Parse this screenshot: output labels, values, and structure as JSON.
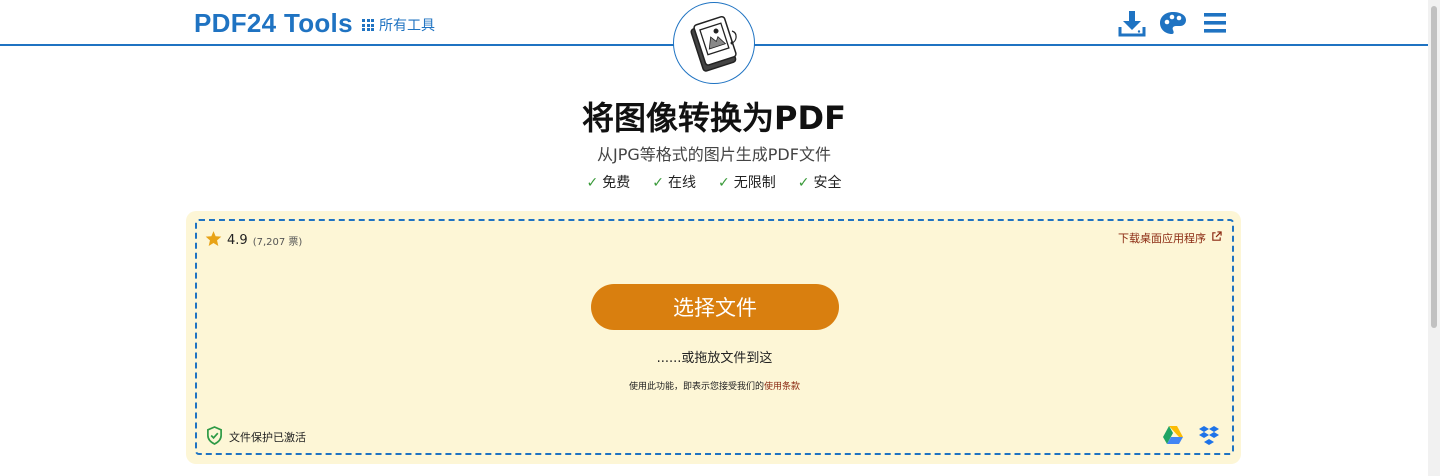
{
  "header": {
    "brand": "PDF24 Tools",
    "all_tools_label": "所有工具",
    "icons": [
      "download-icon",
      "palette-icon",
      "menu-icon"
    ]
  },
  "hero": {
    "title": "将图像转换为PDF",
    "subtitle": "从JPG等格式的图片生成PDF文件",
    "features": [
      {
        "check": "✓",
        "label": "免费"
      },
      {
        "check": "✓",
        "label": "在线"
      },
      {
        "check": "✓",
        "label": "无限制"
      },
      {
        "check": "✓",
        "label": "安全"
      }
    ]
  },
  "dropzone": {
    "rating_value": "4.9",
    "rating_count": "(7,207 票)",
    "desktop_link": "下载桌面应用程序",
    "choose_button": "选择文件",
    "drag_text": "......或拖放文件到这",
    "terms_prefix": "使用此功能，即表示您接受我们的",
    "terms_link": "使用条款",
    "protection": "文件保护已激活",
    "storage_icons": [
      "google-drive-icon",
      "dropbox-icon"
    ]
  },
  "colors": {
    "accent": "#1f73c2",
    "button": "#d97f0f",
    "dropzone_bg": "#fdf6d6",
    "link": "#8b2a12",
    "check": "#3a9a3a",
    "star": "#e8a317"
  }
}
